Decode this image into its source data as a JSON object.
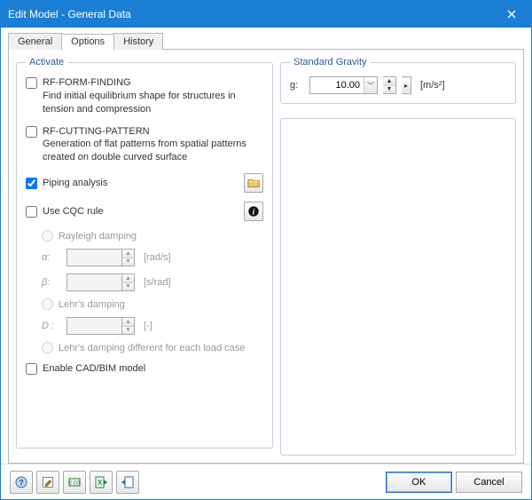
{
  "window": {
    "title": "Edit Model - General Data"
  },
  "tabs": {
    "general": "General",
    "options": "Options",
    "history": "History",
    "active": "options"
  },
  "activate": {
    "legend": "Activate",
    "form_finding": {
      "label": "RF-FORM-FINDING",
      "desc": "Find initial equilibrium shape for structures in tension and compression",
      "checked": false
    },
    "cutting_pattern": {
      "label": "RF-CUTTING-PATTERN",
      "desc": "Generation of flat patterns from spatial patterns created on double curved surface",
      "checked": false
    },
    "piping": {
      "label": "Piping analysis",
      "checked": true
    },
    "cqc": {
      "label": "Use CQC rule",
      "checked": false
    },
    "rayleigh": {
      "label": "Rayleigh damping",
      "alpha_label": "α:",
      "alpha_unit": "[rad/s]",
      "beta_label": "β:",
      "beta_unit": "[s/rad]",
      "alpha_value": "",
      "beta_value": ""
    },
    "lehr": {
      "label": "Lehr's damping",
      "d_label": "D :",
      "d_unit": "[-]",
      "d_value": ""
    },
    "lehr_diff": {
      "label": "Lehr's damping different for each load case"
    },
    "cad_bim": {
      "label": "Enable CAD/BIM model",
      "checked": false
    }
  },
  "gravity": {
    "legend": "Standard Gravity",
    "label": "g:",
    "value": "10.00",
    "unit": "[m/s²]"
  },
  "footer": {
    "ok": "OK",
    "cancel": "Cancel"
  },
  "icons": {
    "close": "close-icon",
    "piping_settings": "folder-icon",
    "info": "info-icon",
    "tool1": "help-icon",
    "tool2": "edit-icon",
    "tool3": "units-icon",
    "tool4": "export-excel-icon",
    "tool5": "import-icon"
  }
}
